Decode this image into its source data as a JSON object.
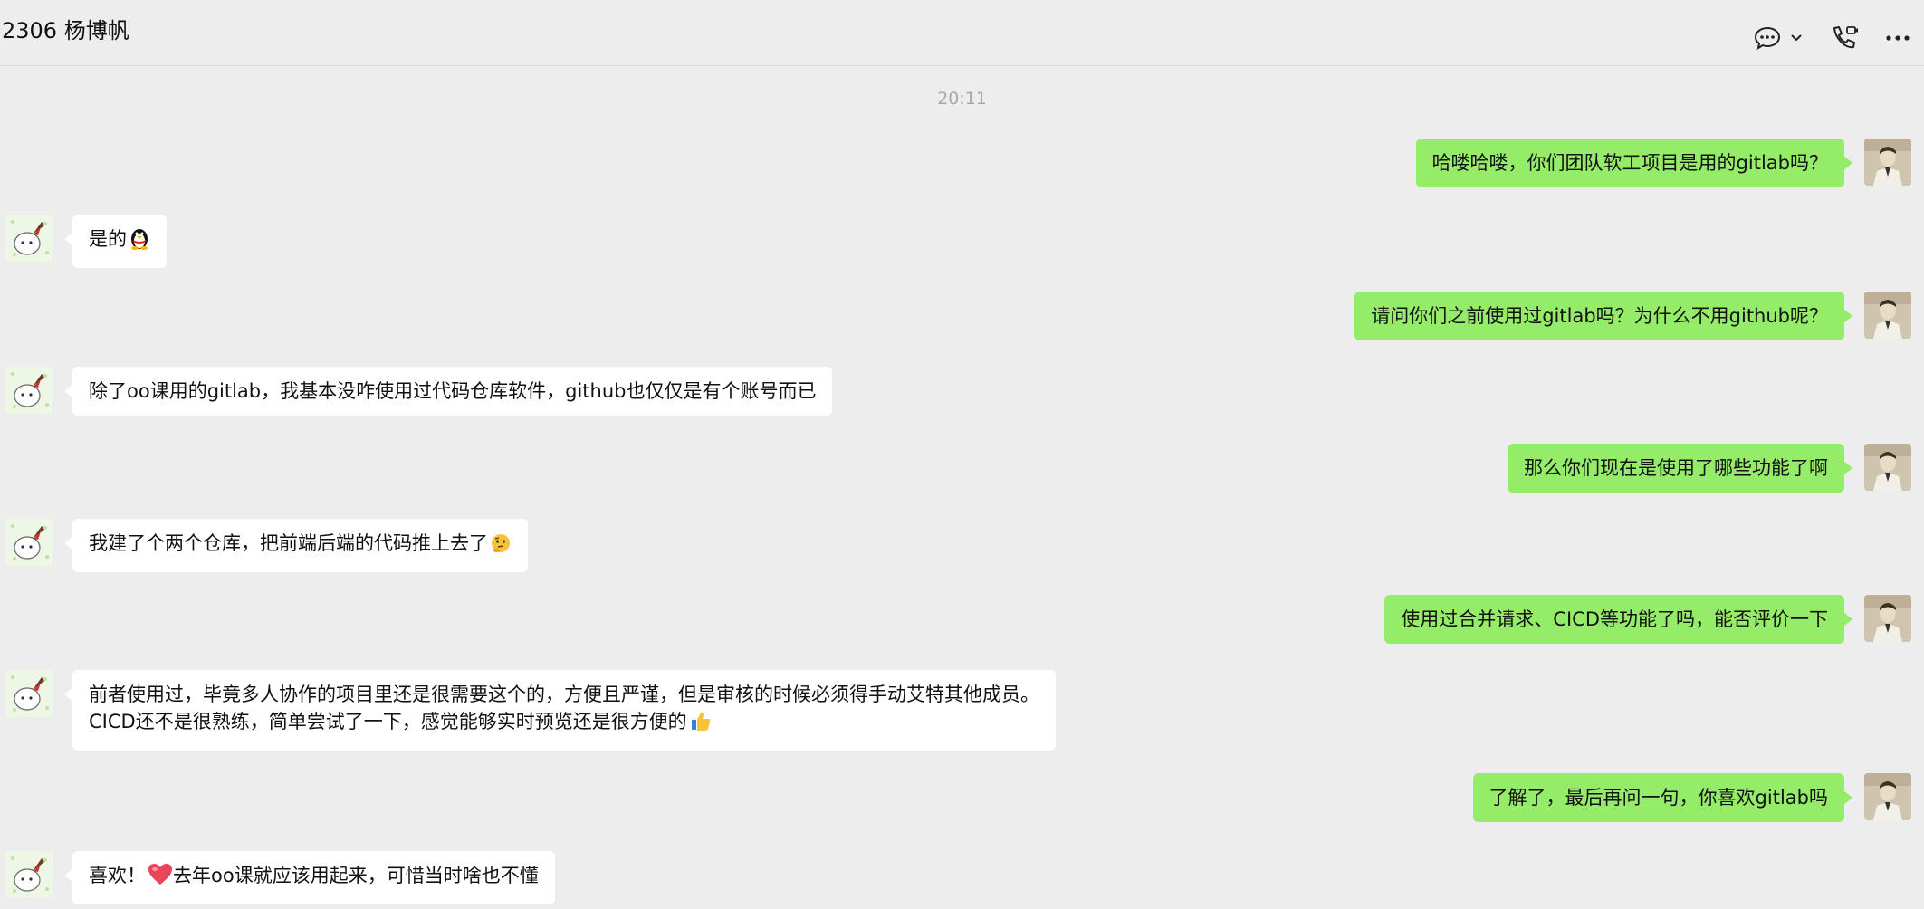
{
  "header": {
    "title": "2306 杨博帆",
    "icons": [
      "chat-icon",
      "chevron-down-icon",
      "phone-video-icon",
      "more-icon"
    ]
  },
  "chat": {
    "timestamp": "20:11",
    "messages": [
      {
        "from": "me",
        "text": "哈喽哈喽，你们团队软工项目是用的gitlab吗？"
      },
      {
        "from": "other",
        "text": "是的",
        "emoji": "penguin-emoji"
      },
      {
        "from": "me",
        "text": "请问你们之前使用过gitlab吗？为什么不用github呢？"
      },
      {
        "from": "other",
        "text": "除了oo课用的gitlab，我基本没咋使用过代码仓库软件，github也仅仅是有个账号而已"
      },
      {
        "from": "me",
        "text": "那么你们现在是使用了哪些功能了啊"
      },
      {
        "from": "other",
        "text": "我建了个两个仓库，把前端后端的代码推上去了",
        "emoji": "thinking-face-emoji"
      },
      {
        "from": "me",
        "text": "使用过合并请求、CICD等功能了吗，能否评价一下"
      },
      {
        "from": "other",
        "line1": "前者使用过，毕竟多人协作的项目里还是很需要这个的，方便且严谨，但是审核的时候必须得手动艾特其他成员。",
        "line2": "CICD还不是很熟练，简单尝试了一下，感觉能够实时预览还是很方便的",
        "emoji": "thumbs-up-emoji"
      },
      {
        "from": "me",
        "text": "了解了，最后再问一句，你喜欢gitlab吗"
      },
      {
        "from": "other",
        "text_before": "喜欢！",
        "emoji": "heart-emoji",
        "text_after": "去年oo课就应该用起来，可惜当时啥也不懂"
      }
    ]
  },
  "colors": {
    "background": "#ededed",
    "my_bubble": "#95ec69",
    "their_bubble": "#ffffff"
  }
}
